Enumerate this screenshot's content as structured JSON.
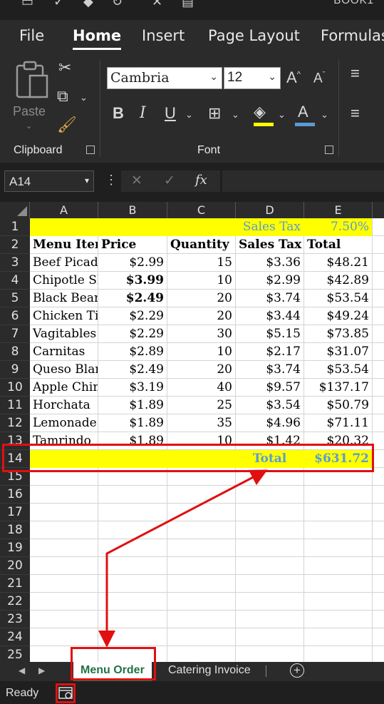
{
  "window": {
    "title_fragment": "BOOK1"
  },
  "ribbon_tabs": [
    "File",
    "Home",
    "Insert",
    "Page Layout",
    "Formulas"
  ],
  "active_tab": "Home",
  "clipboard": {
    "paste_label": "Paste",
    "group_label": "Clipboard"
  },
  "font": {
    "family": "Cambria",
    "size": "12",
    "group_label": "Font",
    "highlight_color": "#ffff00",
    "font_color": "#5b9bd5"
  },
  "formula_bar": {
    "name_box": "A14",
    "fx": "fx",
    "formula": ""
  },
  "columns": [
    "A",
    "B",
    "C",
    "D",
    "E"
  ],
  "rows": [
    {
      "n": "1",
      "cells": [
        "",
        "",
        "",
        "Sales Tax",
        "7.50%"
      ]
    },
    {
      "n": "2",
      "cells": [
        "Menu Item",
        "Price",
        "Quantity",
        "Sales Tax",
        "Total"
      ]
    },
    {
      "n": "3",
      "cells": [
        "Beef Picadillo",
        "$2.99",
        "15",
        "$3.36",
        "$48.21"
      ]
    },
    {
      "n": "4",
      "cells": [
        "Chipotle Shrimp",
        "$3.99",
        "10",
        "$2.99",
        "$42.89"
      ]
    },
    {
      "n": "5",
      "cells": [
        "Black Beans",
        "$2.49",
        "20",
        "$3.74",
        "$53.54"
      ]
    },
    {
      "n": "6",
      "cells": [
        "Chicken Tinga",
        "$2.29",
        "20",
        "$3.44",
        "$49.24"
      ]
    },
    {
      "n": "7",
      "cells": [
        "Vagitables",
        "$2.29",
        "30",
        "$5.15",
        "$73.85"
      ]
    },
    {
      "n": "8",
      "cells": [
        "Carnitas",
        "$2.89",
        "10",
        "$2.17",
        "$31.07"
      ]
    },
    {
      "n": "9",
      "cells": [
        "Queso Blanco",
        "$2.49",
        "20",
        "$3.74",
        "$53.54"
      ]
    },
    {
      "n": "10",
      "cells": [
        "Apple Chimichanga",
        "$3.19",
        "40",
        "$9.57",
        "$137.17"
      ]
    },
    {
      "n": "11",
      "cells": [
        "Horchata",
        "$1.89",
        "25",
        "$3.54",
        "$50.79"
      ]
    },
    {
      "n": "12",
      "cells": [
        "Lemonade",
        "$1.89",
        "35",
        "$4.96",
        "$71.11"
      ]
    },
    {
      "n": "13",
      "cells": [
        "Tamrindo",
        "$1.89",
        "10",
        "$1.42",
        "$20.32"
      ]
    },
    {
      "n": "14",
      "cells": [
        "",
        "",
        "",
        "Total",
        "$631.72"
      ]
    },
    {
      "n": "15",
      "cells": [
        "",
        "",
        "",
        "",
        ""
      ]
    },
    {
      "n": "16",
      "cells": [
        "",
        "",
        "",
        "",
        ""
      ]
    },
    {
      "n": "17",
      "cells": [
        "",
        "",
        "",
        "",
        ""
      ]
    },
    {
      "n": "18",
      "cells": [
        "",
        "",
        "",
        "",
        ""
      ]
    },
    {
      "n": "19",
      "cells": [
        "",
        "",
        "",
        "",
        ""
      ]
    },
    {
      "n": "20",
      "cells": [
        "",
        "",
        "",
        "",
        ""
      ]
    },
    {
      "n": "21",
      "cells": [
        "",
        "",
        "",
        "",
        ""
      ]
    },
    {
      "n": "22",
      "cells": [
        "",
        "",
        "",
        "",
        ""
      ]
    },
    {
      "n": "23",
      "cells": [
        "",
        "",
        "",
        "",
        ""
      ]
    },
    {
      "n": "24",
      "cells": [
        "",
        "",
        "",
        "",
        ""
      ]
    },
    {
      "n": "25",
      "cells": [
        "",
        "",
        "",
        "",
        ""
      ]
    }
  ],
  "sheet_tabs": [
    "Menu Order",
    "Catering Invoice"
  ],
  "active_sheet": "Menu Order",
  "status": {
    "text": "Ready"
  },
  "colors": {
    "fill_yellow": "#ffff00",
    "accent_blue": "#5b9bd5",
    "annotation_red": "#e01010",
    "excel_green": "#217346"
  }
}
